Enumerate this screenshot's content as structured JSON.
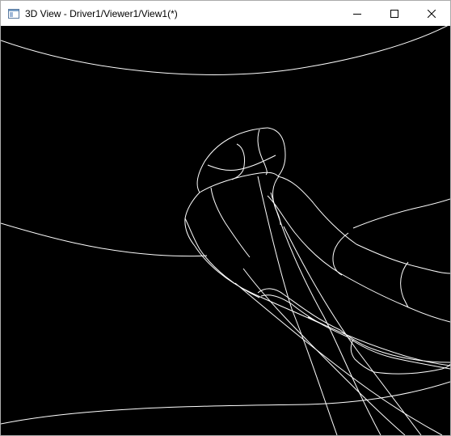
{
  "window": {
    "title": "3D View - Driver1/Viewer1/View1(*)"
  },
  "caption": {
    "minimize_icon": "minimize-icon",
    "maximize_icon": "maximize-icon",
    "close_icon": "close-icon"
  },
  "viewport": {
    "background_color": "#000000",
    "wire_color": "#ffffff",
    "render_mode": "wireframe"
  }
}
